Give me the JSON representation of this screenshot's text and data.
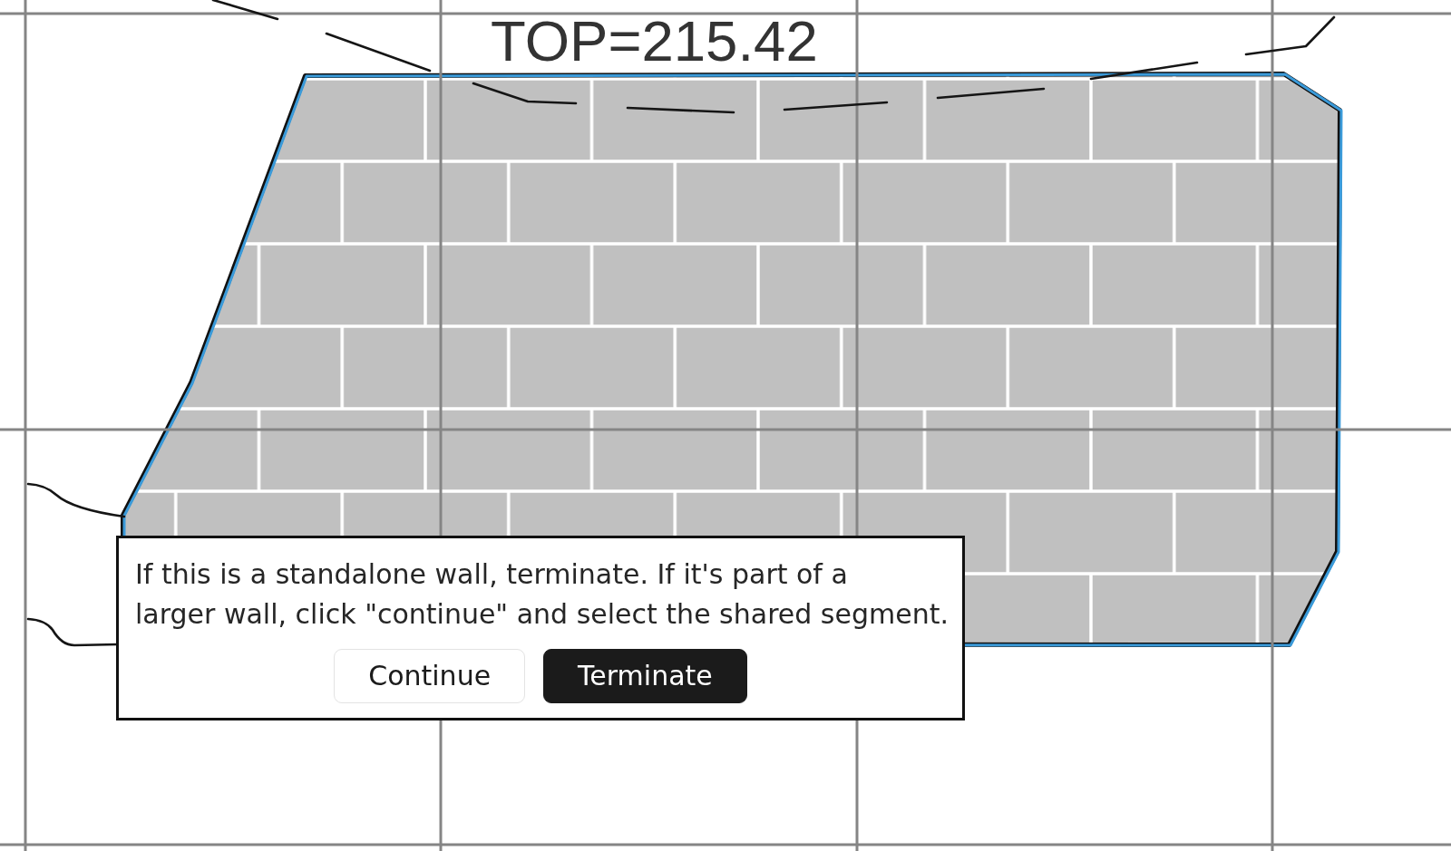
{
  "canvas": {
    "elevation_label": "TOP=215.42",
    "wall": {
      "selected": true
    }
  },
  "dialog": {
    "message_lines": [
      "If this is a standalone wall, terminate. If it's part of a",
      "larger wall, click \"continue\" and select the shared segment."
    ],
    "buttons": [
      {
        "label": "Continue",
        "kind": "secondary"
      },
      {
        "label": "Terminate",
        "kind": "primary"
      }
    ]
  }
}
